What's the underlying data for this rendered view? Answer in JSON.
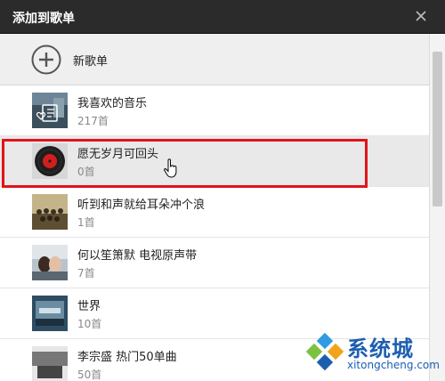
{
  "dialog": {
    "title": "添加到歌单"
  },
  "new_playlist": {
    "label": "新歌单"
  },
  "playlists": [
    {
      "name": "我喜欢的音乐",
      "count": "217首"
    },
    {
      "name": "愿无岁月可回头",
      "count": "0首",
      "selected": true
    },
    {
      "name": "听到和声就给耳朵冲个浪",
      "count": "1首"
    },
    {
      "name": "何以笙箫默 电视原声带",
      "count": "7首"
    },
    {
      "name": "世界",
      "count": "10首"
    },
    {
      "name": "李宗盛 热门50单曲",
      "count": "50首"
    }
  ],
  "watermark": {
    "brand": "系统城",
    "url": "xitongcheng.com"
  },
  "icons": {
    "close": "close-icon",
    "add": "plus-circle-icon",
    "cursor": "hand-pointer-icon"
  },
  "colors": {
    "titlebar": "#2b2b2b",
    "highlight": "#e0141b",
    "watermark": "#1c5fb0"
  }
}
